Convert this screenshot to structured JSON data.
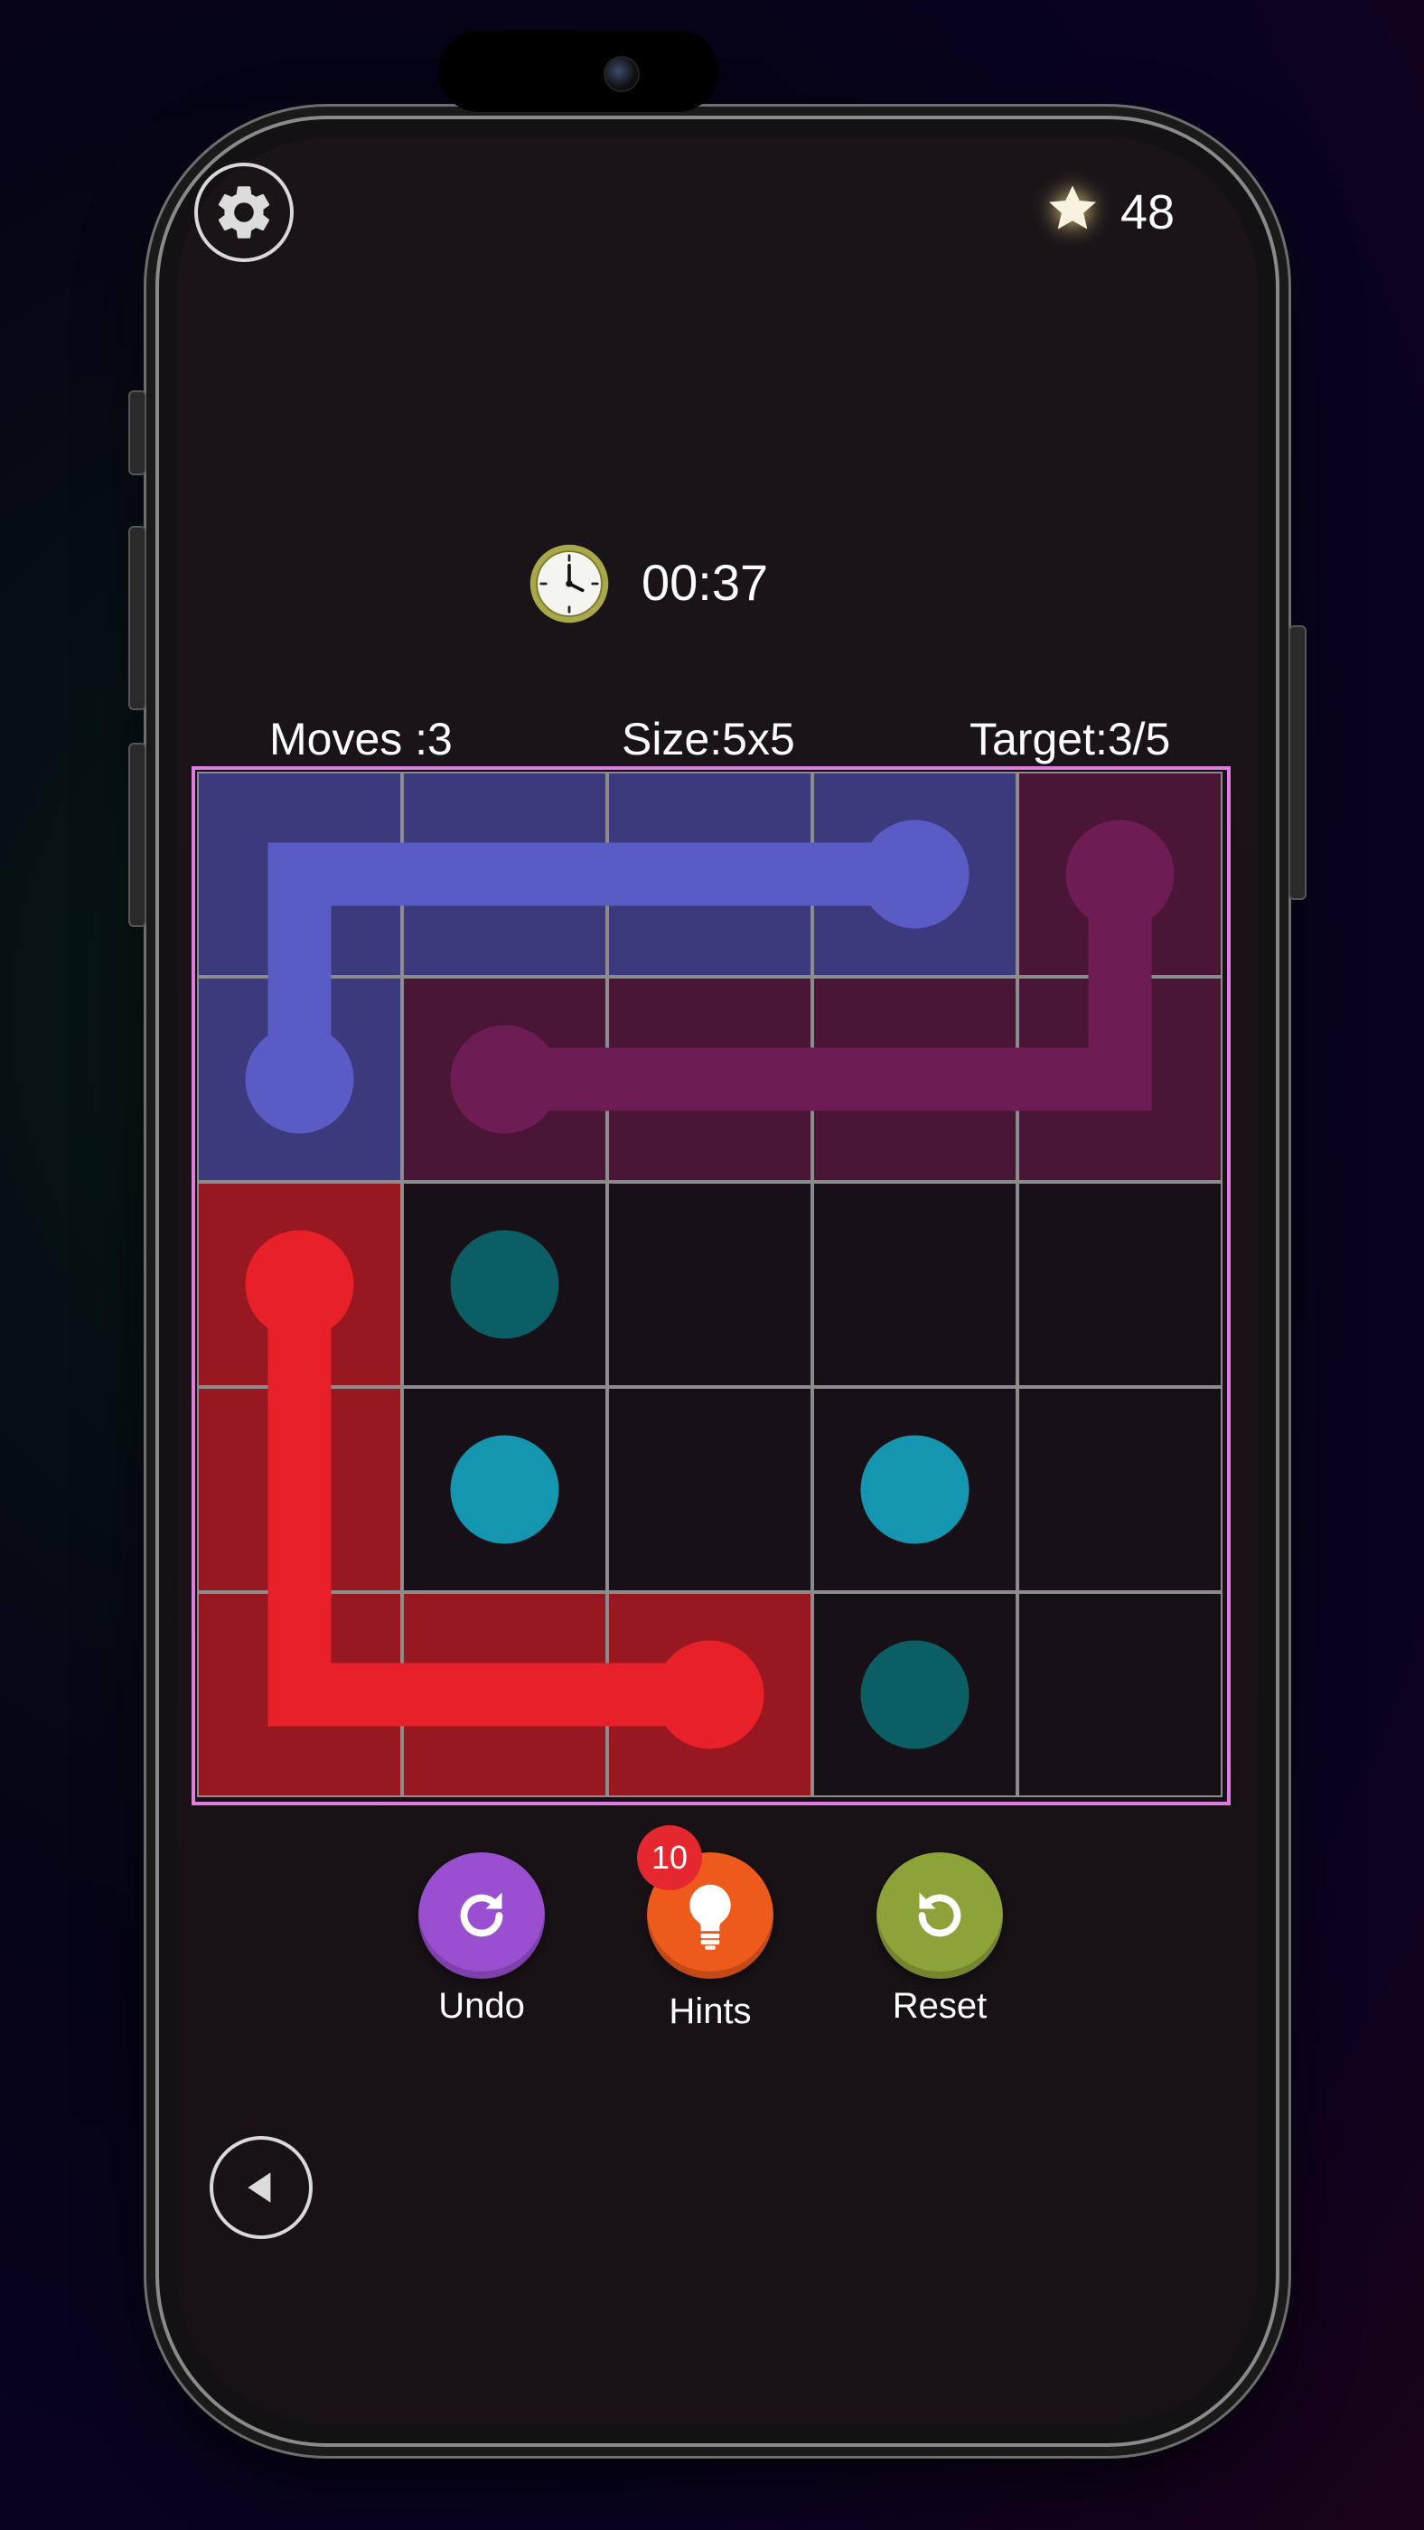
{
  "header": {
    "star_count": "48"
  },
  "timer": {
    "value": "00:37"
  },
  "stats": {
    "moves": "Moves :3",
    "size": "Size:5x5",
    "target": "Target:3/5"
  },
  "board": {
    "rows": 5,
    "cols": 5,
    "colors": {
      "blue": "#5b5bc6",
      "blue_cell": "#3a3a7c",
      "purple": "#6e1c54",
      "purple_cell": "#4a1636",
      "red": "#e8202a",
      "red_cell": "#971820",
      "dark_teal": "#0b5e64",
      "light_teal": "#1596b0",
      "grid_border": "#e07be0"
    },
    "paths": [
      {
        "color": "blue",
        "cells": [
          [
            3,
            0
          ],
          [
            2,
            0
          ],
          [
            1,
            0
          ],
          [
            0,
            0
          ],
          [
            0,
            1
          ]
        ]
      },
      {
        "color": "purple",
        "cells": [
          [
            4,
            0
          ],
          [
            4,
            1
          ],
          [
            3,
            1
          ],
          [
            2,
            1
          ],
          [
            1,
            1
          ]
        ]
      },
      {
        "color": "red",
        "cells": [
          [
            0,
            2
          ],
          [
            0,
            3
          ],
          [
            0,
            4
          ],
          [
            1,
            4
          ],
          [
            2,
            4
          ]
        ]
      }
    ],
    "dots": [
      {
        "color": "dark_teal",
        "cell": [
          1,
          2
        ]
      },
      {
        "color": "light_teal",
        "cell": [
          1,
          3
        ]
      },
      {
        "color": "light_teal",
        "cell": [
          3,
          3
        ]
      },
      {
        "color": "dark_teal",
        "cell": [
          3,
          4
        ]
      }
    ]
  },
  "controls": {
    "undo_label": "Undo",
    "hints_label": "Hints",
    "hints_count": "10",
    "reset_label": "Reset",
    "undo_color": "#9a4fd0",
    "hints_color": "#ee5a1c",
    "reset_color": "#8ea23a"
  }
}
